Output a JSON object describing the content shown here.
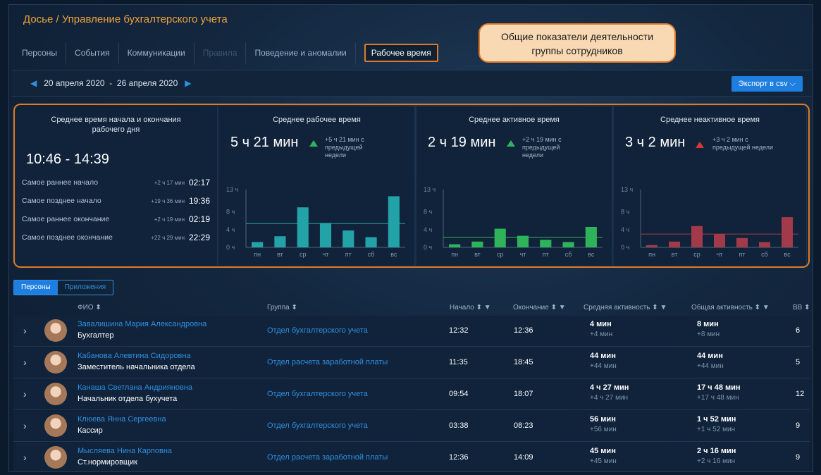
{
  "breadcrumb": "Досье / Управление бухгалтерского учета",
  "tabs": [
    {
      "label": "Персоны",
      "state": "normal"
    },
    {
      "label": "События",
      "state": "normal"
    },
    {
      "label": "Коммуникации",
      "state": "normal"
    },
    {
      "label": "Правила",
      "state": "disabled"
    },
    {
      "label": "Поведение и аномалии",
      "state": "normal"
    },
    {
      "label": "Рабочее время",
      "state": "active"
    }
  ],
  "callout": {
    "line1": "Общие показатели деятельности",
    "line2": "группы сотрудников"
  },
  "daterange": {
    "from": "20 апреля 2020",
    "sep": "-",
    "to": "26 апреля 2020"
  },
  "export_label": "Экспорт в csv",
  "card_start_end": {
    "title_line1": "Среднее время начала и окончания",
    "title_line2": "рабочего дня",
    "range": "10:46 - 14:39",
    "rows": [
      {
        "label": "Самое раннее начало",
        "delta": "+2 ч 17 мин",
        "value": "02:17"
      },
      {
        "label": "Самое позднее начало",
        "delta": "+19 ч 36 мин",
        "value": "19:36"
      },
      {
        "label": "Самое раннее окончание",
        "delta": "+2 ч 19 мин",
        "value": "02:19"
      },
      {
        "label": "Самое позднее окончание",
        "delta": "+22 ч 29 мин",
        "value": "22:29"
      }
    ]
  },
  "cards": [
    {
      "title": "Среднее рабочее время",
      "value": "5 ч 21 мин",
      "trend": "up",
      "delta_line1": "+5 ч 21 мин с",
      "delta_line2": "предыдущей",
      "delta_line3": "недели",
      "color": "#23a3a8",
      "dim": false
    },
    {
      "title": "Среднее активное время",
      "value": "2 ч 19 мин",
      "trend": "up",
      "delta_line1": "+2 ч 19 мин с",
      "delta_line2": "предыдущей",
      "delta_line3": "недели",
      "color": "#2fb35a",
      "dim": false
    },
    {
      "title": "Среднее неактивное время",
      "value": "3 ч 2 мин",
      "trend": "down",
      "delta_line1": "+3 ч 2 мин с",
      "delta_line2": "предыдущей недели",
      "delta_line3": "",
      "color": "#a23a4a",
      "dim": true
    }
  ],
  "chart_data": [
    {
      "type": "bar",
      "categories": [
        "пн",
        "вт",
        "ср",
        "чт",
        "пт",
        "сб",
        "вс"
      ],
      "values": [
        1.2,
        2.5,
        9,
        5.5,
        3.8,
        2.3,
        11.5
      ],
      "avg": 5.35,
      "yticks": [
        "0 ч",
        "4 ч",
        "8 ч",
        "13 ч"
      ],
      "ylim": [
        0,
        13
      ],
      "color": "#23a3a8"
    },
    {
      "type": "bar",
      "categories": [
        "пн",
        "вт",
        "ср",
        "чт",
        "пт",
        "сб",
        "вс"
      ],
      "values": [
        0.7,
        1.3,
        4.2,
        2.6,
        1.7,
        1.2,
        4.6
      ],
      "avg": 2.3,
      "yticks": [
        "0 ч",
        "4 ч",
        "8 ч",
        "13 ч"
      ],
      "ylim": [
        0,
        13
      ],
      "color": "#2fb35a"
    },
    {
      "type": "bar",
      "categories": [
        "пн",
        "вт",
        "ср",
        "чт",
        "пт",
        "сб",
        "вс"
      ],
      "values": [
        0.5,
        1.3,
        4.8,
        3.0,
        2.1,
        1.2,
        6.8
      ],
      "avg": 3.0,
      "yticks": [
        "0 ч",
        "4 ч",
        "8 ч",
        "13 ч"
      ],
      "ylim": [
        0,
        13
      ],
      "color": "#a23a4a"
    }
  ],
  "subtabs": [
    {
      "label": "Персоны",
      "active": true
    },
    {
      "label": "Приложения",
      "active": false
    }
  ],
  "table": {
    "headers": {
      "name": "ФИО",
      "group": "Группа",
      "start": "Начало",
      "end": "Окончание",
      "avg_activity": "Средняя активность",
      "total_activity": "Общая активность",
      "extra": "ВВ"
    },
    "rows": [
      {
        "name": "Завалишина Мария Александровна",
        "role": "Бухгалтер",
        "group": "Отдел бухгалтерского учета",
        "start": "12:32",
        "end": "12:36",
        "avg": "4 мин",
        "avg_delta": "+4 мин",
        "total": "8 мин",
        "total_delta": "+8 мин",
        "extra": "6"
      },
      {
        "name": "Кабанова Алевтина Сидоровна",
        "role": "Заместитель начальника отдела",
        "group": "Отдел расчета заработной платы",
        "start": "11:35",
        "end": "18:45",
        "avg": "44 мин",
        "avg_delta": "+44 мин",
        "total": "44 мин",
        "total_delta": "+44 мин",
        "extra": "5"
      },
      {
        "name": "Канаша Светлана Андрияновна",
        "role": "Начальник отдела бухучета",
        "group": "Отдел бухгалтерского учета",
        "start": "09:54",
        "end": "18:07",
        "avg": "4 ч 27 мин",
        "avg_delta": "+4 ч 27 мин",
        "total": "17 ч 48 мин",
        "total_delta": "+17 ч 48 мин",
        "extra": "12"
      },
      {
        "name": "Клюева Янна Сергеевна",
        "role": "Кассир",
        "group": "Отдел бухгалтерского учета",
        "start": "03:38",
        "end": "08:23",
        "avg": "56 мин",
        "avg_delta": "+56 мин",
        "total": "1 ч 52 мин",
        "total_delta": "+1 ч 52 мин",
        "extra": "9"
      },
      {
        "name": "Мысляева Нина Карповна",
        "role": "Ст.нормировщик",
        "group": "Отдел расчета заработной платы",
        "start": "12:36",
        "end": "14:09",
        "avg": "45 мин",
        "avg_delta": "+45 мин",
        "total": "2 ч 16 мин",
        "total_delta": "+2 ч 16 мин",
        "extra": "9"
      }
    ]
  }
}
